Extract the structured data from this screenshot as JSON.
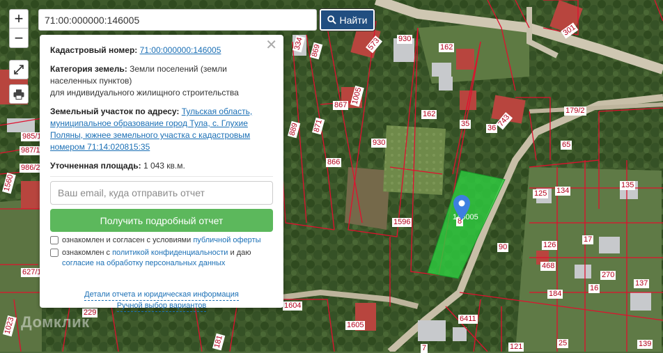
{
  "search": {
    "value": "71:00:000000:146005",
    "button_label": "Найти"
  },
  "controls": {
    "zoom_in": "+",
    "zoom_out": "−"
  },
  "popup": {
    "cadastral_label": "Кадастровый номер:",
    "cadastral_value": "71:00:000000:146005",
    "category_label": "Категория земель:",
    "category_value": "Земли поселений (земли населенных пунктов)",
    "category_use": "для индивидуального жилищного строительства",
    "address_label": "Земельный участок по адресу:",
    "address_value": "Тульская область, муниципальное образование город Тула, с. Глухие Поляны, южнее земельного участка с кадастровым номером 71:14:020815:35",
    "area_label": "Уточненная площадь:",
    "area_value": "1 043 кв.м.",
    "email_placeholder": "Ваш email, куда отправить отчет",
    "report_button": "Получить подробный отчет",
    "offer_text": "ознакомлен и согласен с условиями",
    "offer_link": "публичной оферты",
    "privacy_text": "ознакомлен с",
    "privacy_link": "политикой конфиденциальности",
    "privacy_tail": "и даю",
    "consent_link": "согласие на обработку персональных данных",
    "details_link": "Детали отчета и юридическая информация",
    "manual_link": "Ручной выбор вариантов"
  },
  "watermark": "Домклик",
  "selected_parcel_label": "146005",
  "parcel_labels": [
    "334",
    "869",
    "573",
    "930",
    "162",
    "301",
    "867",
    "1005",
    "871",
    "889",
    "162",
    "35",
    "36",
    "743",
    "179/2",
    "65",
    "985/1",
    "987/1",
    "986/2",
    "1560",
    "930",
    "866",
    "134",
    "135",
    "125",
    "1596",
    "8",
    "17",
    "126",
    "90",
    "468",
    "627/1",
    "270",
    "137",
    "184",
    "16",
    "1604",
    "229",
    "6411",
    "1023",
    "1605",
    "181",
    "7",
    "121",
    "25",
    "139"
  ],
  "colors": {
    "selected_fill": "#2ecc40",
    "parcel_stroke": "#e0102e",
    "button_blue": "#214e80",
    "report_green": "#5cb85c",
    "marker_blue": "#3d7fe0"
  }
}
